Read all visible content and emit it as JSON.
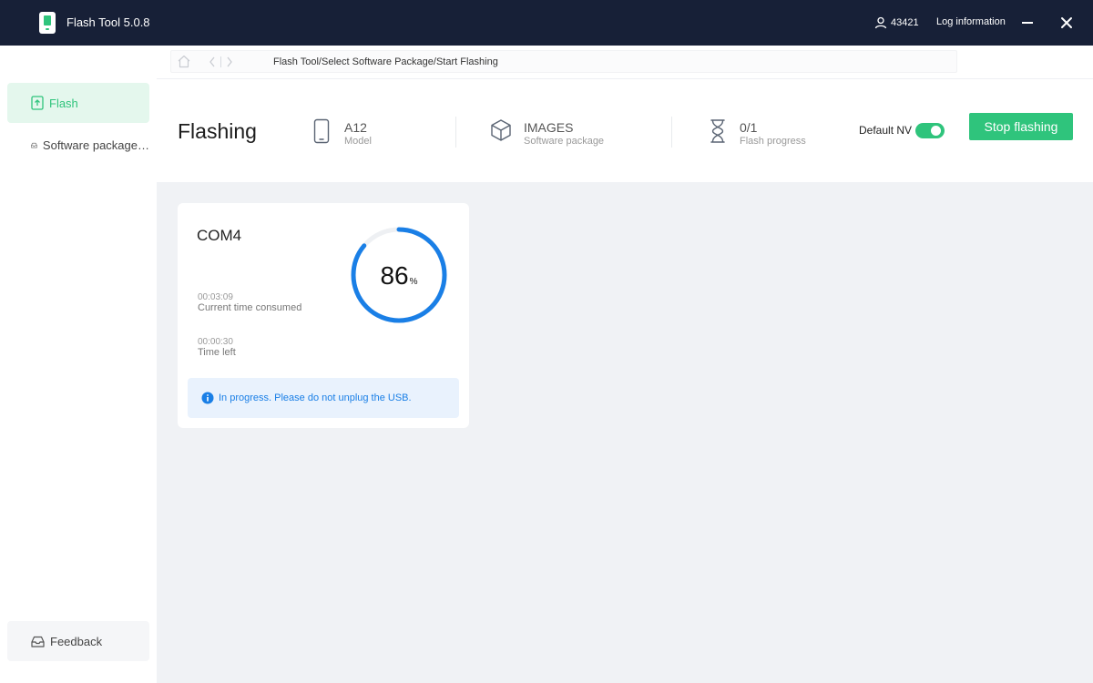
{
  "app": {
    "title": "Flash Tool 5.0.8"
  },
  "titlebar": {
    "user_id": "43421",
    "log_label": "Log information"
  },
  "sidebar": {
    "items": [
      {
        "label": "Flash",
        "active": true
      },
      {
        "label": "Software package…",
        "active": false
      }
    ],
    "feedback_label": "Feedback"
  },
  "breadcrumb": {
    "path": "Flash Tool/Select Software Package/Start Flashing"
  },
  "header": {
    "title": "Flashing",
    "model": {
      "value": "A12",
      "caption": "Model"
    },
    "package": {
      "value": "IMAGES",
      "caption": "Software package"
    },
    "progress": {
      "value": "0/1",
      "caption": "Flash progress"
    },
    "default_nv_label": "Default NV",
    "default_nv_on": true,
    "stop_button": "Stop flashing"
  },
  "device_card": {
    "port": "COM4",
    "percent": 86,
    "percent_text": "86",
    "percent_sign": "%",
    "elapsed_value": "00:03:09",
    "elapsed_caption": "Current time consumed",
    "remaining_value": "00:00:30",
    "remaining_caption": "Time left",
    "notice": "In progress. Please do not unplug the USB."
  },
  "colors": {
    "titlebar_bg": "#172037",
    "accent_green": "#2fc47c",
    "progress_blue": "#1a7fe6",
    "content_bg": "#f0f2f5",
    "notice_bg": "#e9f2fd"
  },
  "icons": {
    "logo": "phone-battery-logo-icon",
    "user": "user-icon",
    "minimize": "minimize-icon",
    "close": "close-icon",
    "flash": "flash-upload-icon",
    "package": "inbox-icon",
    "feedback": "inbox-icon",
    "home": "home-icon",
    "back": "chevron-left-icon",
    "forward": "chevron-right-icon",
    "model": "phone-icon",
    "software": "cube-icon",
    "progress": "hourglass-icon",
    "info": "info-icon"
  }
}
